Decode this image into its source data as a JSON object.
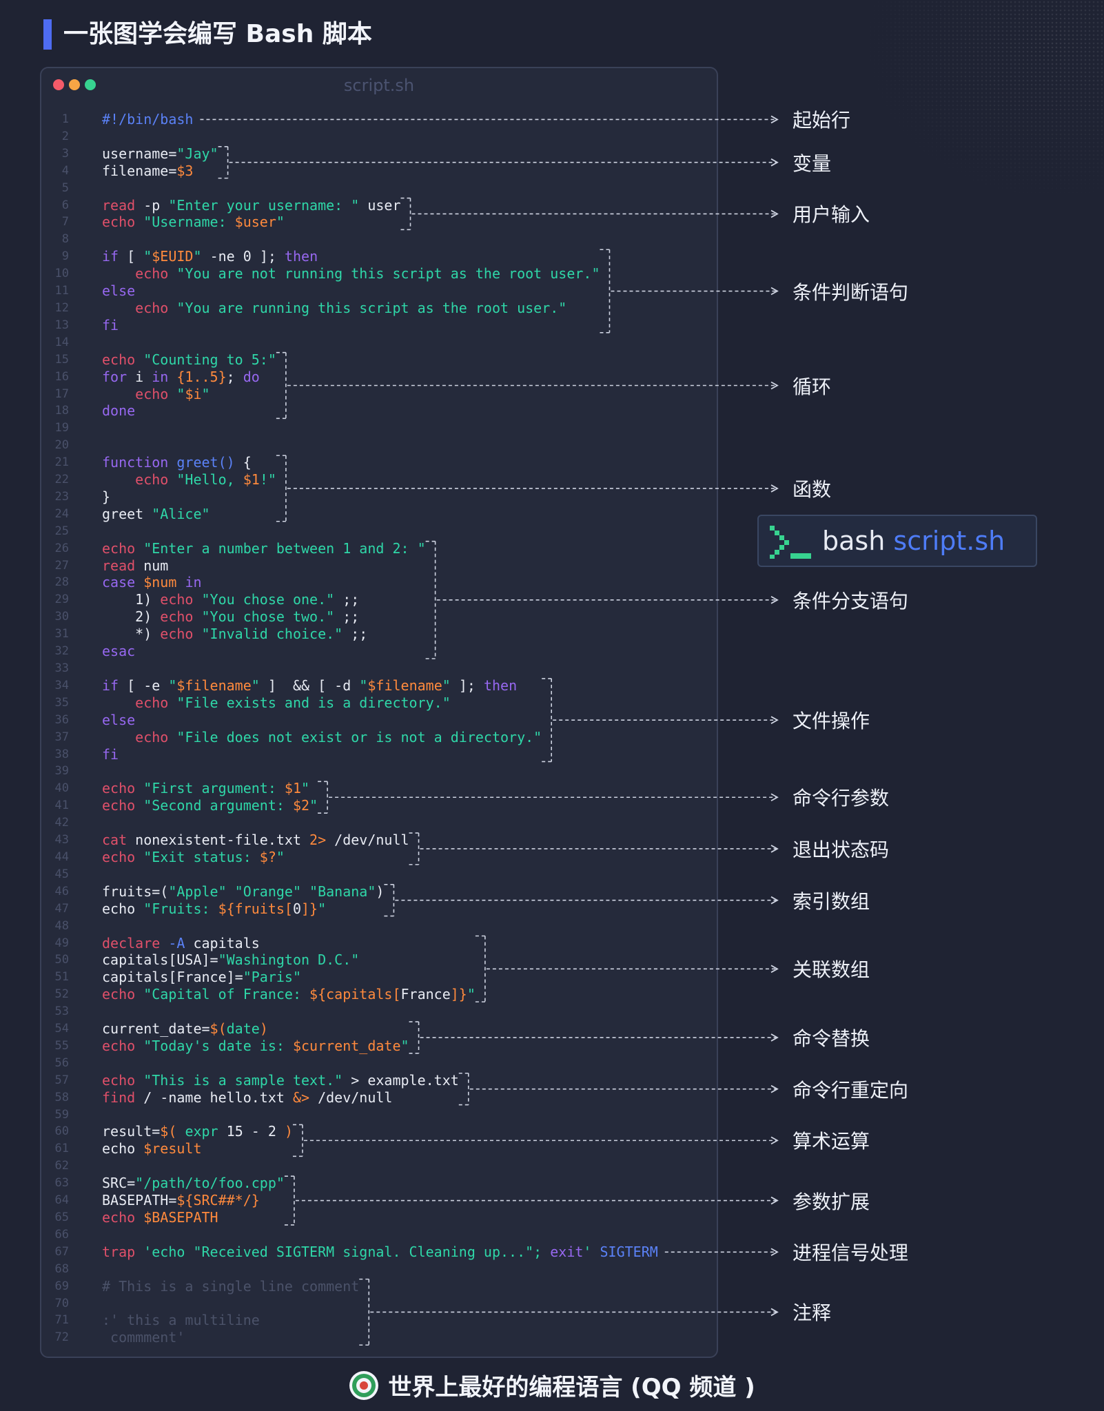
{
  "page_title": "一张图学会编写 Bash 脚本",
  "window": {
    "filename": "script.sh"
  },
  "code_lines": [
    [
      {
        "t": "#!/bin/bash",
        "c": "fn"
      }
    ],
    [],
    [
      {
        "t": "username="
      },
      {
        "t": "\"Jay\"",
        "c": "st"
      }
    ],
    [
      {
        "t": "filename="
      },
      {
        "t": "$3",
        "c": "vr"
      }
    ],
    [],
    [
      {
        "t": "read",
        "c": "kw"
      },
      {
        "t": " -p "
      },
      {
        "t": "\"Enter your username: \"",
        "c": "st"
      },
      {
        "t": " user"
      }
    ],
    [
      {
        "t": "echo",
        "c": "kw"
      },
      {
        "t": " "
      },
      {
        "t": "\"Username: ",
        "c": "st"
      },
      {
        "t": "$user",
        "c": "vr"
      },
      {
        "t": "\"",
        "c": "st"
      }
    ],
    [],
    [
      {
        "t": "if",
        "c": "cf"
      },
      {
        "t": " [ "
      },
      {
        "t": "\"",
        "c": "st"
      },
      {
        "t": "$EUID",
        "c": "vr"
      },
      {
        "t": "\"",
        "c": "st"
      },
      {
        "t": " -ne 0 ]; "
      },
      {
        "t": "then",
        "c": "cf"
      }
    ],
    [
      {
        "t": "    "
      },
      {
        "t": "echo",
        "c": "kw"
      },
      {
        "t": " "
      },
      {
        "t": "\"You are not running this script as the root user.\"",
        "c": "st"
      }
    ],
    [
      {
        "t": "else",
        "c": "cf"
      }
    ],
    [
      {
        "t": "    "
      },
      {
        "t": "echo",
        "c": "kw"
      },
      {
        "t": " "
      },
      {
        "t": "\"You are running this script as the root user.\"",
        "c": "st"
      }
    ],
    [
      {
        "t": "fi",
        "c": "cf"
      }
    ],
    [],
    [
      {
        "t": "echo",
        "c": "kw"
      },
      {
        "t": " "
      },
      {
        "t": "\"Counting to 5:\"",
        "c": "st"
      }
    ],
    [
      {
        "t": "for",
        "c": "cf"
      },
      {
        "t": " i "
      },
      {
        "t": "in",
        "c": "cf"
      },
      {
        "t": " "
      },
      {
        "t": "{1..5}",
        "c": "vr"
      },
      {
        "t": "; "
      },
      {
        "t": "do",
        "c": "cf"
      }
    ],
    [
      {
        "t": "    "
      },
      {
        "t": "echo",
        "c": "kw"
      },
      {
        "t": " "
      },
      {
        "t": "\"",
        "c": "st"
      },
      {
        "t": "$i",
        "c": "vr"
      },
      {
        "t": "\"",
        "c": "st"
      }
    ],
    [
      {
        "t": "done",
        "c": "cf"
      }
    ],
    [],
    [],
    [
      {
        "t": "function",
        "c": "cf"
      },
      {
        "t": " "
      },
      {
        "t": "greet()",
        "c": "fn"
      },
      {
        "t": " {"
      }
    ],
    [
      {
        "t": "    "
      },
      {
        "t": "echo",
        "c": "kw"
      },
      {
        "t": " "
      },
      {
        "t": "\"Hello, ",
        "c": "st"
      },
      {
        "t": "$1",
        "c": "vr"
      },
      {
        "t": "!\"",
        "c": "st"
      }
    ],
    [
      {
        "t": "}"
      }
    ],
    [
      {
        "t": "greet "
      },
      {
        "t": "\"Alice\"",
        "c": "st"
      }
    ],
    [],
    [
      {
        "t": "echo",
        "c": "kw"
      },
      {
        "t": " "
      },
      {
        "t": "\"Enter a number between 1 and 2: \"",
        "c": "st"
      }
    ],
    [
      {
        "t": "read",
        "c": "kw"
      },
      {
        "t": " num"
      }
    ],
    [
      {
        "t": "case",
        "c": "cf"
      },
      {
        "t": " "
      },
      {
        "t": "$num",
        "c": "vr"
      },
      {
        "t": " "
      },
      {
        "t": "in",
        "c": "cf"
      }
    ],
    [
      {
        "t": "    1) "
      },
      {
        "t": "echo",
        "c": "kw"
      },
      {
        "t": " "
      },
      {
        "t": "\"You chose one.\"",
        "c": "st"
      },
      {
        "t": " ;;"
      }
    ],
    [
      {
        "t": "    2) "
      },
      {
        "t": "echo",
        "c": "kw"
      },
      {
        "t": " "
      },
      {
        "t": "\"You chose two.\"",
        "c": "st"
      },
      {
        "t": " ;;"
      }
    ],
    [
      {
        "t": "    *) "
      },
      {
        "t": "echo",
        "c": "kw"
      },
      {
        "t": " "
      },
      {
        "t": "\"Invalid choice.\"",
        "c": "st"
      },
      {
        "t": " ;;"
      }
    ],
    [
      {
        "t": "esac",
        "c": "cf"
      }
    ],
    [],
    [
      {
        "t": "if",
        "c": "cf"
      },
      {
        "t": " [ -e "
      },
      {
        "t": "\"",
        "c": "st"
      },
      {
        "t": "$filename",
        "c": "vr"
      },
      {
        "t": "\"",
        "c": "st"
      },
      {
        "t": " ]  && [ -d "
      },
      {
        "t": "\"",
        "c": "st"
      },
      {
        "t": "$filename",
        "c": "vr"
      },
      {
        "t": "\"",
        "c": "st"
      },
      {
        "t": " ]; "
      },
      {
        "t": "then",
        "c": "cf"
      }
    ],
    [
      {
        "t": "    "
      },
      {
        "t": "echo",
        "c": "kw"
      },
      {
        "t": " "
      },
      {
        "t": "\"File exists and is a directory.\"",
        "c": "st"
      }
    ],
    [
      {
        "t": "else",
        "c": "cf"
      }
    ],
    [
      {
        "t": "    "
      },
      {
        "t": "echo",
        "c": "kw"
      },
      {
        "t": " "
      },
      {
        "t": "\"File does not exist or is not a directory.\"",
        "c": "st"
      }
    ],
    [
      {
        "t": "fi",
        "c": "cf"
      }
    ],
    [],
    [
      {
        "t": "echo",
        "c": "kw"
      },
      {
        "t": " "
      },
      {
        "t": "\"First argument: ",
        "c": "st"
      },
      {
        "t": "$1",
        "c": "vr"
      },
      {
        "t": "\"",
        "c": "st"
      }
    ],
    [
      {
        "t": "echo",
        "c": "kw"
      },
      {
        "t": " "
      },
      {
        "t": "\"Second argument: ",
        "c": "st"
      },
      {
        "t": "$2",
        "c": "vr"
      },
      {
        "t": "\"",
        "c": "st"
      }
    ],
    [],
    [
      {
        "t": "cat",
        "c": "kw"
      },
      {
        "t": " nonexistent-file.txt "
      },
      {
        "t": "2>",
        "c": "vr"
      },
      {
        "t": " /dev/null"
      }
    ],
    [
      {
        "t": "echo",
        "c": "kw"
      },
      {
        "t": " "
      },
      {
        "t": "\"Exit status: ",
        "c": "st"
      },
      {
        "t": "$?",
        "c": "vr"
      },
      {
        "t": "\"",
        "c": "st"
      }
    ],
    [],
    [
      {
        "t": "fruits=("
      },
      {
        "t": "\"Apple\"",
        "c": "st"
      },
      {
        "t": " "
      },
      {
        "t": "\"Orange\"",
        "c": "st"
      },
      {
        "t": " "
      },
      {
        "t": "\"Banana\"",
        "c": "st"
      },
      {
        "t": ")"
      }
    ],
    [
      {
        "t": "echo "
      },
      {
        "t": "\"Fruits: ",
        "c": "st"
      },
      {
        "t": "${fruits[",
        "c": "vr"
      },
      {
        "t": "0"
      },
      {
        "t": "]}",
        "c": "vr"
      },
      {
        "t": "\"",
        "c": "st"
      }
    ],
    [],
    [
      {
        "t": "declare",
        "c": "kw"
      },
      {
        "t": " "
      },
      {
        "t": "-A",
        "c": "fn"
      },
      {
        "t": " capitals"
      }
    ],
    [
      {
        "t": "capitals[USA]="
      },
      {
        "t": "\"Washington D.C.\"",
        "c": "st"
      }
    ],
    [
      {
        "t": "capitals[France]="
      },
      {
        "t": "\"Paris\"",
        "c": "st"
      }
    ],
    [
      {
        "t": "echo",
        "c": "kw"
      },
      {
        "t": " "
      },
      {
        "t": "\"Capital of France: ",
        "c": "st"
      },
      {
        "t": "${capitals[",
        "c": "vr"
      },
      {
        "t": "France"
      },
      {
        "t": "]}",
        "c": "vr"
      },
      {
        "t": "\"",
        "c": "st"
      }
    ],
    [],
    [
      {
        "t": "current_date="
      },
      {
        "t": "$(",
        "c": "vr"
      },
      {
        "t": "date",
        "c": "st"
      },
      {
        "t": ")",
        "c": "vr"
      }
    ],
    [
      {
        "t": "echo",
        "c": "kw"
      },
      {
        "t": " "
      },
      {
        "t": "\"Today's date is: ",
        "c": "st"
      },
      {
        "t": "$current_date",
        "c": "vr"
      },
      {
        "t": "\"",
        "c": "st"
      }
    ],
    [],
    [
      {
        "t": "echo",
        "c": "kw"
      },
      {
        "t": " "
      },
      {
        "t": "\"This is a sample text.\"",
        "c": "st"
      },
      {
        "t": " > example.txt"
      }
    ],
    [
      {
        "t": "find",
        "c": "kw"
      },
      {
        "t": " / -name hello.txt "
      },
      {
        "t": "&>",
        "c": "vr"
      },
      {
        "t": " /dev/null"
      }
    ],
    [],
    [
      {
        "t": "result="
      },
      {
        "t": "$(",
        "c": "vr"
      },
      {
        "t": " "
      },
      {
        "t": "expr",
        "c": "st"
      },
      {
        "t": " 15 - 2 "
      },
      {
        "t": ")",
        "c": "vr"
      }
    ],
    [
      {
        "t": "echo "
      },
      {
        "t": "$result",
        "c": "vr"
      }
    ],
    [],
    [
      {
        "t": "SRC="
      },
      {
        "t": "\"/path/to/foo.cpp\"",
        "c": "st"
      }
    ],
    [
      {
        "t": "BASEPATH="
      },
      {
        "t": "${SRC##*/}",
        "c": "vr"
      }
    ],
    [
      {
        "t": "echo",
        "c": "kw"
      },
      {
        "t": " "
      },
      {
        "t": "$BASEPATH",
        "c": "vr"
      }
    ],
    [],
    [
      {
        "t": "trap",
        "c": "kw"
      },
      {
        "t": " "
      },
      {
        "t": "'echo \"Received SIGTERM signal. Cleaning up...\"; ",
        "c": "st"
      },
      {
        "t": "exit",
        "c": "cf"
      },
      {
        "t": "'",
        "c": "st"
      },
      {
        "t": " "
      },
      {
        "t": "SIGTERM",
        "c": "fn"
      }
    ],
    [],
    [
      {
        "t": "# This is a single line comment",
        "c": "cm"
      }
    ],
    [],
    [
      {
        "t": ":' this a multiline",
        "c": "cm"
      }
    ],
    [
      {
        "t": " commment'",
        "c": "cm"
      }
    ]
  ],
  "annotations": [
    {
      "label": "起始行",
      "start": 1,
      "end": 1
    },
    {
      "label": "变量",
      "start": 3,
      "end": 4
    },
    {
      "label": "用户输入",
      "start": 6,
      "end": 7
    },
    {
      "label": "条件判断语句",
      "start": 9,
      "end": 13
    },
    {
      "label": "循环",
      "start": 15,
      "end": 18
    },
    {
      "label": "函数",
      "start": 21,
      "end": 24
    },
    {
      "label": "条件分支语句",
      "start": 26,
      "end": 32
    },
    {
      "label": "文件操作",
      "start": 34,
      "end": 38
    },
    {
      "label": "命令行参数",
      "start": 40,
      "end": 41
    },
    {
      "label": "退出状态码",
      "start": 43,
      "end": 44
    },
    {
      "label": "索引数组",
      "start": 46,
      "end": 47
    },
    {
      "label": "关联数组",
      "start": 49,
      "end": 52
    },
    {
      "label": "命令替换",
      "start": 54,
      "end": 55
    },
    {
      "label": "命令行重定向",
      "start": 57,
      "end": 58
    },
    {
      "label": "算术运算",
      "start": 60,
      "end": 61
    },
    {
      "label": "参数扩展",
      "start": 63,
      "end": 65
    },
    {
      "label": "进程信号处理",
      "start": 67,
      "end": 67
    },
    {
      "label": "注释",
      "start": 69,
      "end": 72
    }
  ],
  "terminal": {
    "command": "bash",
    "argument": "script.sh"
  },
  "footer": {
    "text": "世界上最好的编程语言 (QQ 频道 )"
  },
  "colors": {
    "background": "#1f2333",
    "window": "#252a3b",
    "keyword": "#e0506a",
    "control": "#9768f0",
    "string": "#2fd7a8",
    "variable": "#ff8a3d",
    "function": "#5b82f7",
    "comment": "#4b5269",
    "accent": "#4e6cf2",
    "terminal_icon": "#37d390"
  }
}
